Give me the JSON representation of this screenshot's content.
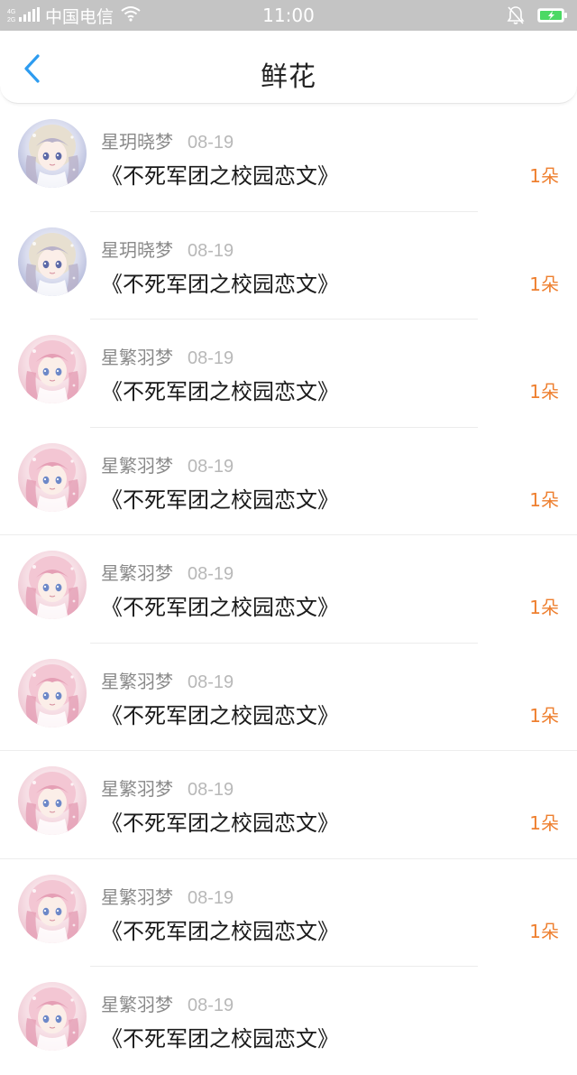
{
  "status_bar": {
    "carrier": "中国电信",
    "time": "11:00"
  },
  "header": {
    "title": "鲜花"
  },
  "colors": {
    "accent_back": "#2d9cf0",
    "count_orange": "#ee7f2f"
  },
  "items": [
    {
      "username": "星玥晓梦",
      "date": "08-19",
      "book_title": "《不死军团之校园恋文》",
      "count": "1朵",
      "avatar": "avatar-blue"
    },
    {
      "username": "星玥晓梦",
      "date": "08-19",
      "book_title": "《不死军团之校园恋文》",
      "count": "1朵",
      "avatar": "avatar-blue"
    },
    {
      "username": "星繁羽梦",
      "date": "08-19",
      "book_title": "《不死军团之校园恋文》",
      "count": "1朵",
      "avatar": "avatar-pink"
    },
    {
      "username": "星繁羽梦",
      "date": "08-19",
      "book_title": "《不死军团之校园恋文》",
      "count": "1朵",
      "avatar": "avatar-pink"
    },
    {
      "username": "星繁羽梦",
      "date": "08-19",
      "book_title": "《不死军团之校园恋文》",
      "count": "1朵",
      "avatar": "avatar-pink"
    },
    {
      "username": "星繁羽梦",
      "date": "08-19",
      "book_title": "《不死军团之校园恋文》",
      "count": "1朵",
      "avatar": "avatar-pink"
    },
    {
      "username": "星繁羽梦",
      "date": "08-19",
      "book_title": "《不死军团之校园恋文》",
      "count": "1朵",
      "avatar": "avatar-pink"
    },
    {
      "username": "星繁羽梦",
      "date": "08-19",
      "book_title": "《不死军团之校园恋文》",
      "count": "1朵",
      "avatar": "avatar-pink"
    },
    {
      "username": "星繁羽梦",
      "date": "08-19",
      "book_title": "《不死军团之校园恋文》",
      "count": "",
      "avatar": "avatar-pink"
    }
  ]
}
